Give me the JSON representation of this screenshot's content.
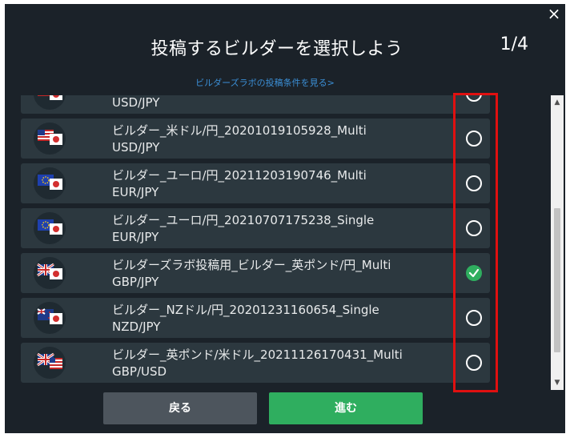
{
  "dialog": {
    "title": "投稿するビルダーを選択しよう",
    "step": "1/4",
    "close_icon": "×",
    "conditions_link": "ビルダーズラボの投稿条件を見る>"
  },
  "builders": [
    {
      "name": "",
      "pair": "USD/JPY",
      "flag": "us-jp",
      "selected": false
    },
    {
      "name": "ビルダー_米ドル/円_20201019105928_Multi",
      "pair": "USD/JPY",
      "flag": "us-jp",
      "selected": false
    },
    {
      "name": "ビルダー_ユーロ/円_20211203190746_Multi",
      "pair": "EUR/JPY",
      "flag": "eu-jp",
      "selected": false
    },
    {
      "name": "ビルダー_ユーロ/円_20210707175238_Single",
      "pair": "EUR/JPY",
      "flag": "eu-jp",
      "selected": false
    },
    {
      "name": "ビルダーズラボ投稿用_ビルダー_英ポンド/円_Multi",
      "pair": "GBP/JPY",
      "flag": "gb-jp",
      "selected": true
    },
    {
      "name": "ビルダー_NZドル/円_20201231160654_Single",
      "pair": "NZD/JPY",
      "flag": "nz-jp",
      "selected": false
    },
    {
      "name": "ビルダー_英ポンド/米ドル_20211126170431_Multi",
      "pair": "GBP/USD",
      "flag": "gb-us",
      "selected": false
    }
  ],
  "buttons": {
    "back_label": "戻る",
    "next_label": "進む"
  },
  "colors": {
    "background": "#1b2229",
    "row": "#2c383f",
    "accent_green": "#2fae5f",
    "link_blue": "#3b8fd6",
    "highlight_red": "#e01010"
  }
}
